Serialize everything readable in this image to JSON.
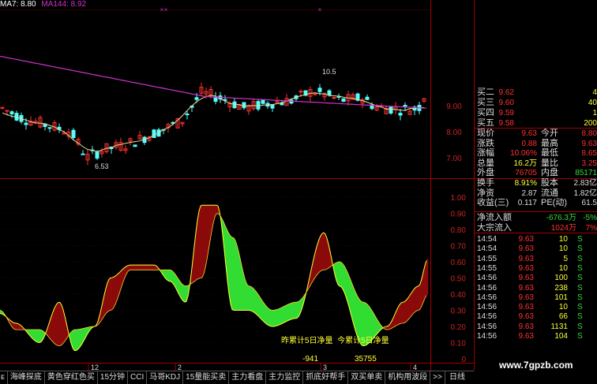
{
  "header": {
    "ma7_label": "MA7: 8.80",
    "ma144_label": "MA144: 8.92",
    "ma7_color": "#ffffff",
    "ma144_color": "#cc33cc"
  },
  "price_axis": {
    "labels": [
      "9.00",
      "8.00",
      "7.00"
    ],
    "high_marker": "10.5",
    "low_marker": "6.53"
  },
  "indicator_axis": {
    "labels": [
      "1.00",
      "0.90",
      "0.80",
      "0.70",
      "0.60",
      "0.50",
      "0.40",
      "0.30",
      "0.20",
      "0.10",
      "0"
    ],
    "text_yesterday": "昨累计5日净量",
    "text_today": "今累计5日净量",
    "value_yesterday": "-941",
    "value_today": "35755"
  },
  "date_markers": [
    "12",
    "2",
    "3",
    "4"
  ],
  "quote": {
    "bids": [
      {
        "label": "买二",
        "price": "9.62",
        "vol": "4"
      },
      {
        "label": "买三",
        "price": "9.60",
        "vol": "40"
      },
      {
        "label": "买四",
        "price": "9.59",
        "vol": "1"
      },
      {
        "label": "买五",
        "price": "9.58",
        "vol": "200"
      }
    ],
    "rows": [
      {
        "l1": "现价",
        "v1": "9.63",
        "l2": "今开",
        "v2": "8.80",
        "c1": "#ff3030",
        "c2": "#ff3030"
      },
      {
        "l1": "涨跌",
        "v1": "0.88",
        "l2": "最高",
        "v2": "9.63",
        "c1": "#ff3030",
        "c2": "#ff3030"
      },
      {
        "l1": "涨幅",
        "v1": "10.06%",
        "l2": "最低",
        "v2": "8.65",
        "c1": "#ff3030",
        "c2": "#ff3030"
      },
      {
        "l1": "总量",
        "v1": "16.2万",
        "l2": "量比",
        "v2": "3.25",
        "c1": "#ffff33",
        "c2": "#ff3030"
      },
      {
        "l1": "外盘",
        "v1": "76705",
        "l2": "内盘",
        "v2": "85171",
        "c1": "#ff3030",
        "c2": "#33dd33"
      },
      {
        "l1": "换手",
        "v1": "8.91%",
        "l2": "股本",
        "v2": "2.83亿",
        "c1": "#ffff33",
        "c2": "#dddddd"
      },
      {
        "l1": "净资",
        "v1": "2.87",
        "l2": "流通",
        "v2": "1.82亿",
        "c1": "#dddddd",
        "c2": "#dddddd"
      },
      {
        "l1": "收益(三)",
        "v1": "0.117",
        "l2": "PE(动)",
        "v2": "61.5",
        "c1": "#dddddd",
        "c2": "#dddddd"
      }
    ],
    "flows": [
      {
        "label": "净流入额",
        "value": "-676.3万",
        "pct": "-5%",
        "color": "#33dd33"
      },
      {
        "label": "大宗流入",
        "value": "1024万",
        "pct": "7%",
        "color": "#ff3030"
      }
    ],
    "ticks": [
      {
        "time": "14:54",
        "price": "9.63",
        "vol": "10",
        "side": "S"
      },
      {
        "time": "14:54",
        "price": "9.63",
        "vol": "10",
        "side": "S"
      },
      {
        "time": "14:55",
        "price": "9.63",
        "vol": "5",
        "side": "S"
      },
      {
        "time": "14:55",
        "price": "9.63",
        "vol": "10",
        "side": "S"
      },
      {
        "time": "14:56",
        "price": "9.63",
        "vol": "100",
        "side": "S"
      },
      {
        "time": "14:56",
        "price": "9.63",
        "vol": "238",
        "side": "S"
      },
      {
        "time": "14:56",
        "price": "9.63",
        "vol": "101",
        "side": "S"
      },
      {
        "time": "14:56",
        "price": "9.63",
        "vol": "10",
        "side": "S"
      },
      {
        "time": "14:56",
        "price": "9.63",
        "vol": "66",
        "side": "S"
      },
      {
        "time": "14:56",
        "price": "9.63",
        "vol": "1131",
        "side": "S"
      },
      {
        "time": "14:56",
        "price": "9.63",
        "vol": "104",
        "side": "S"
      }
    ]
  },
  "tabs": [
    "ᴇ",
    "海峰探底",
    "黄色穿红色买",
    "15分钟",
    "CCI",
    "马哥KDJ",
    "15量能买卖",
    "主力看盘",
    "主力监控",
    "抓底好帮手",
    "双买单卖",
    "机构用波段",
    ">>"
  ],
  "period_label": "日线",
  "watermark": "www.7gpzb.com"
}
